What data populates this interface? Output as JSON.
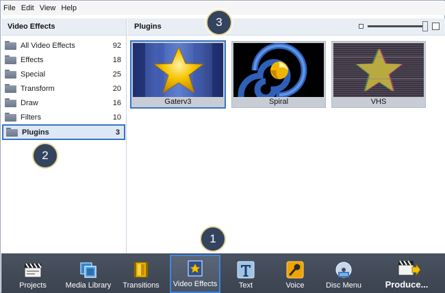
{
  "menu": [
    "File",
    "Edit",
    "View",
    "Help"
  ],
  "left_panel": {
    "title": "Video Effects",
    "items": [
      {
        "label": "All Video Effects",
        "count": "92"
      },
      {
        "label": "Effects",
        "count": "18"
      },
      {
        "label": "Special",
        "count": "25"
      },
      {
        "label": "Transform",
        "count": "20"
      },
      {
        "label": "Draw",
        "count": "16"
      },
      {
        "label": "Filters",
        "count": "10"
      },
      {
        "label": "Plugins",
        "count": "3"
      }
    ],
    "selected_index": 6
  },
  "right_panel": {
    "title": "Plugins",
    "tiles": [
      {
        "label": "Gaterv3",
        "selected": true
      },
      {
        "label": "Spiral",
        "selected": false
      },
      {
        "label": "VHS",
        "selected": false
      }
    ]
  },
  "toolbar": {
    "items": [
      {
        "label": "Projects",
        "icon": "clapperboard-icon"
      },
      {
        "label": "Media Library",
        "icon": "film-frames-icon"
      },
      {
        "label": "Transitions",
        "icon": "transition-icon"
      },
      {
        "label": "Video Effects",
        "icon": "star-frame-icon",
        "active": true
      },
      {
        "label": "Text",
        "icon": "text-t-icon"
      },
      {
        "label": "Voice",
        "icon": "microphone-icon"
      },
      {
        "label": "Disc Menu",
        "icon": "disc-icon"
      },
      {
        "label": "Produce...",
        "icon": "produce-icon"
      }
    ]
  },
  "badges": [
    "1",
    "2",
    "3"
  ],
  "colors": {
    "accent": "#3573c4",
    "toolbar_bg": "#434b59",
    "header_bg": "#e9eef5",
    "badge_bg": "#34445e"
  }
}
